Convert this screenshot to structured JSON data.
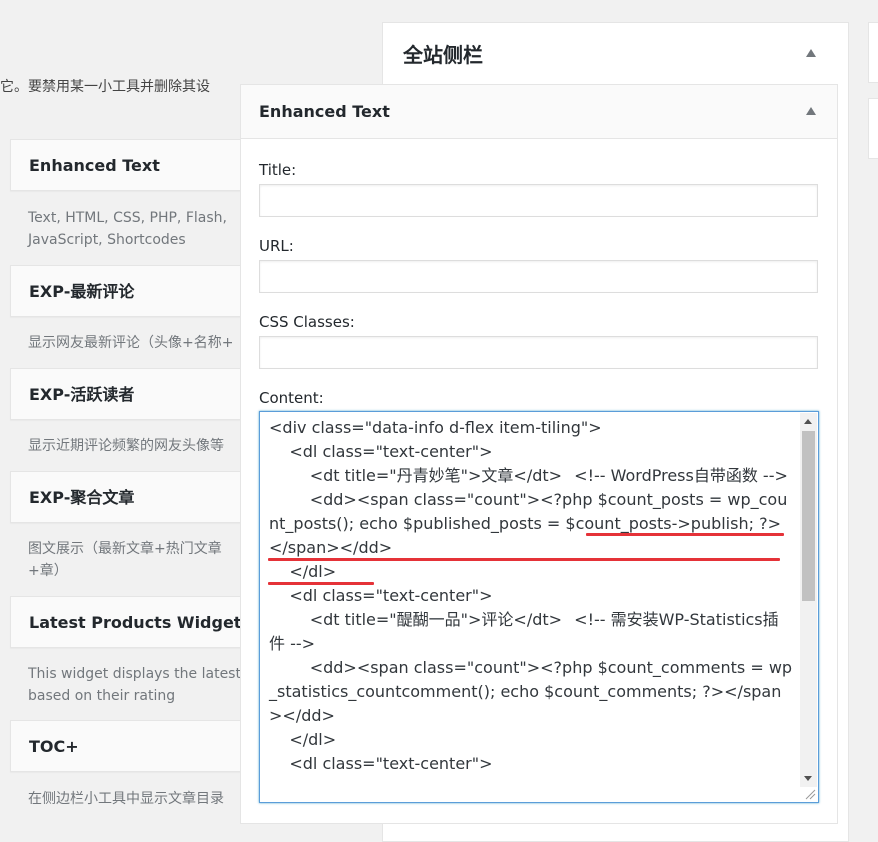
{
  "intro_text": "它。要禁用某一小工具并删除其设",
  "widgets": [
    {
      "title": "Enhanced Text",
      "desc": "Text, HTML, CSS, PHP, Flash, JavaScript, Shortcodes"
    },
    {
      "title": "EXP-最新评论",
      "desc": "显示网友最新评论（头像+名称+"
    },
    {
      "title": "EXP-活跃读者",
      "desc": "显示近期评论频繁的网友头像等"
    },
    {
      "title": "EXP-聚合文章",
      "desc": "图文展示（最新文章+热门文章+章）"
    },
    {
      "title": "Latest Products Widget",
      "desc": "This widget displays the latest products based on their rating"
    },
    {
      "title": "TOC+",
      "desc": "在侧边栏小工具中显示文章目录"
    }
  ],
  "sidebar": {
    "title": "全站侧栏"
  },
  "editor": {
    "title": "Enhanced Text",
    "fields": {
      "title_label": "Title:",
      "title_value": "",
      "url_label": "URL:",
      "url_value": "",
      "css_label": "CSS Classes:",
      "css_value": "",
      "content_label": "Content:"
    },
    "content": "<div class=\"data-info d-flex item-tiling\">\n\t<dl class=\"text-center\">\n\t\t<dt title=\"丹青妙笔\">文章</dt>\t<!-- WordPress自带函数 -->\n\t\t<dd><span class=\"count\"><?php $count_posts = wp_count_posts(); echo $published_posts = $count_posts->publish; ?></span></dd>\n\t</dl>\n\t<dl class=\"text-center\">\n\t\t<dt title=\"醍醐一品\">评论</dt>\t<!-- 需安装WP-Statistics插件 -->\n\t\t<dd><span class=\"count\"><?php $count_comments = wp_statistics_countcomment(); echo $count_comments; ?></span></dd>\n\t</dl>\n\t<dl class=\"text-center\">"
  },
  "colors": {
    "accent": "#5b9dd9",
    "highlight": "#e53238"
  }
}
